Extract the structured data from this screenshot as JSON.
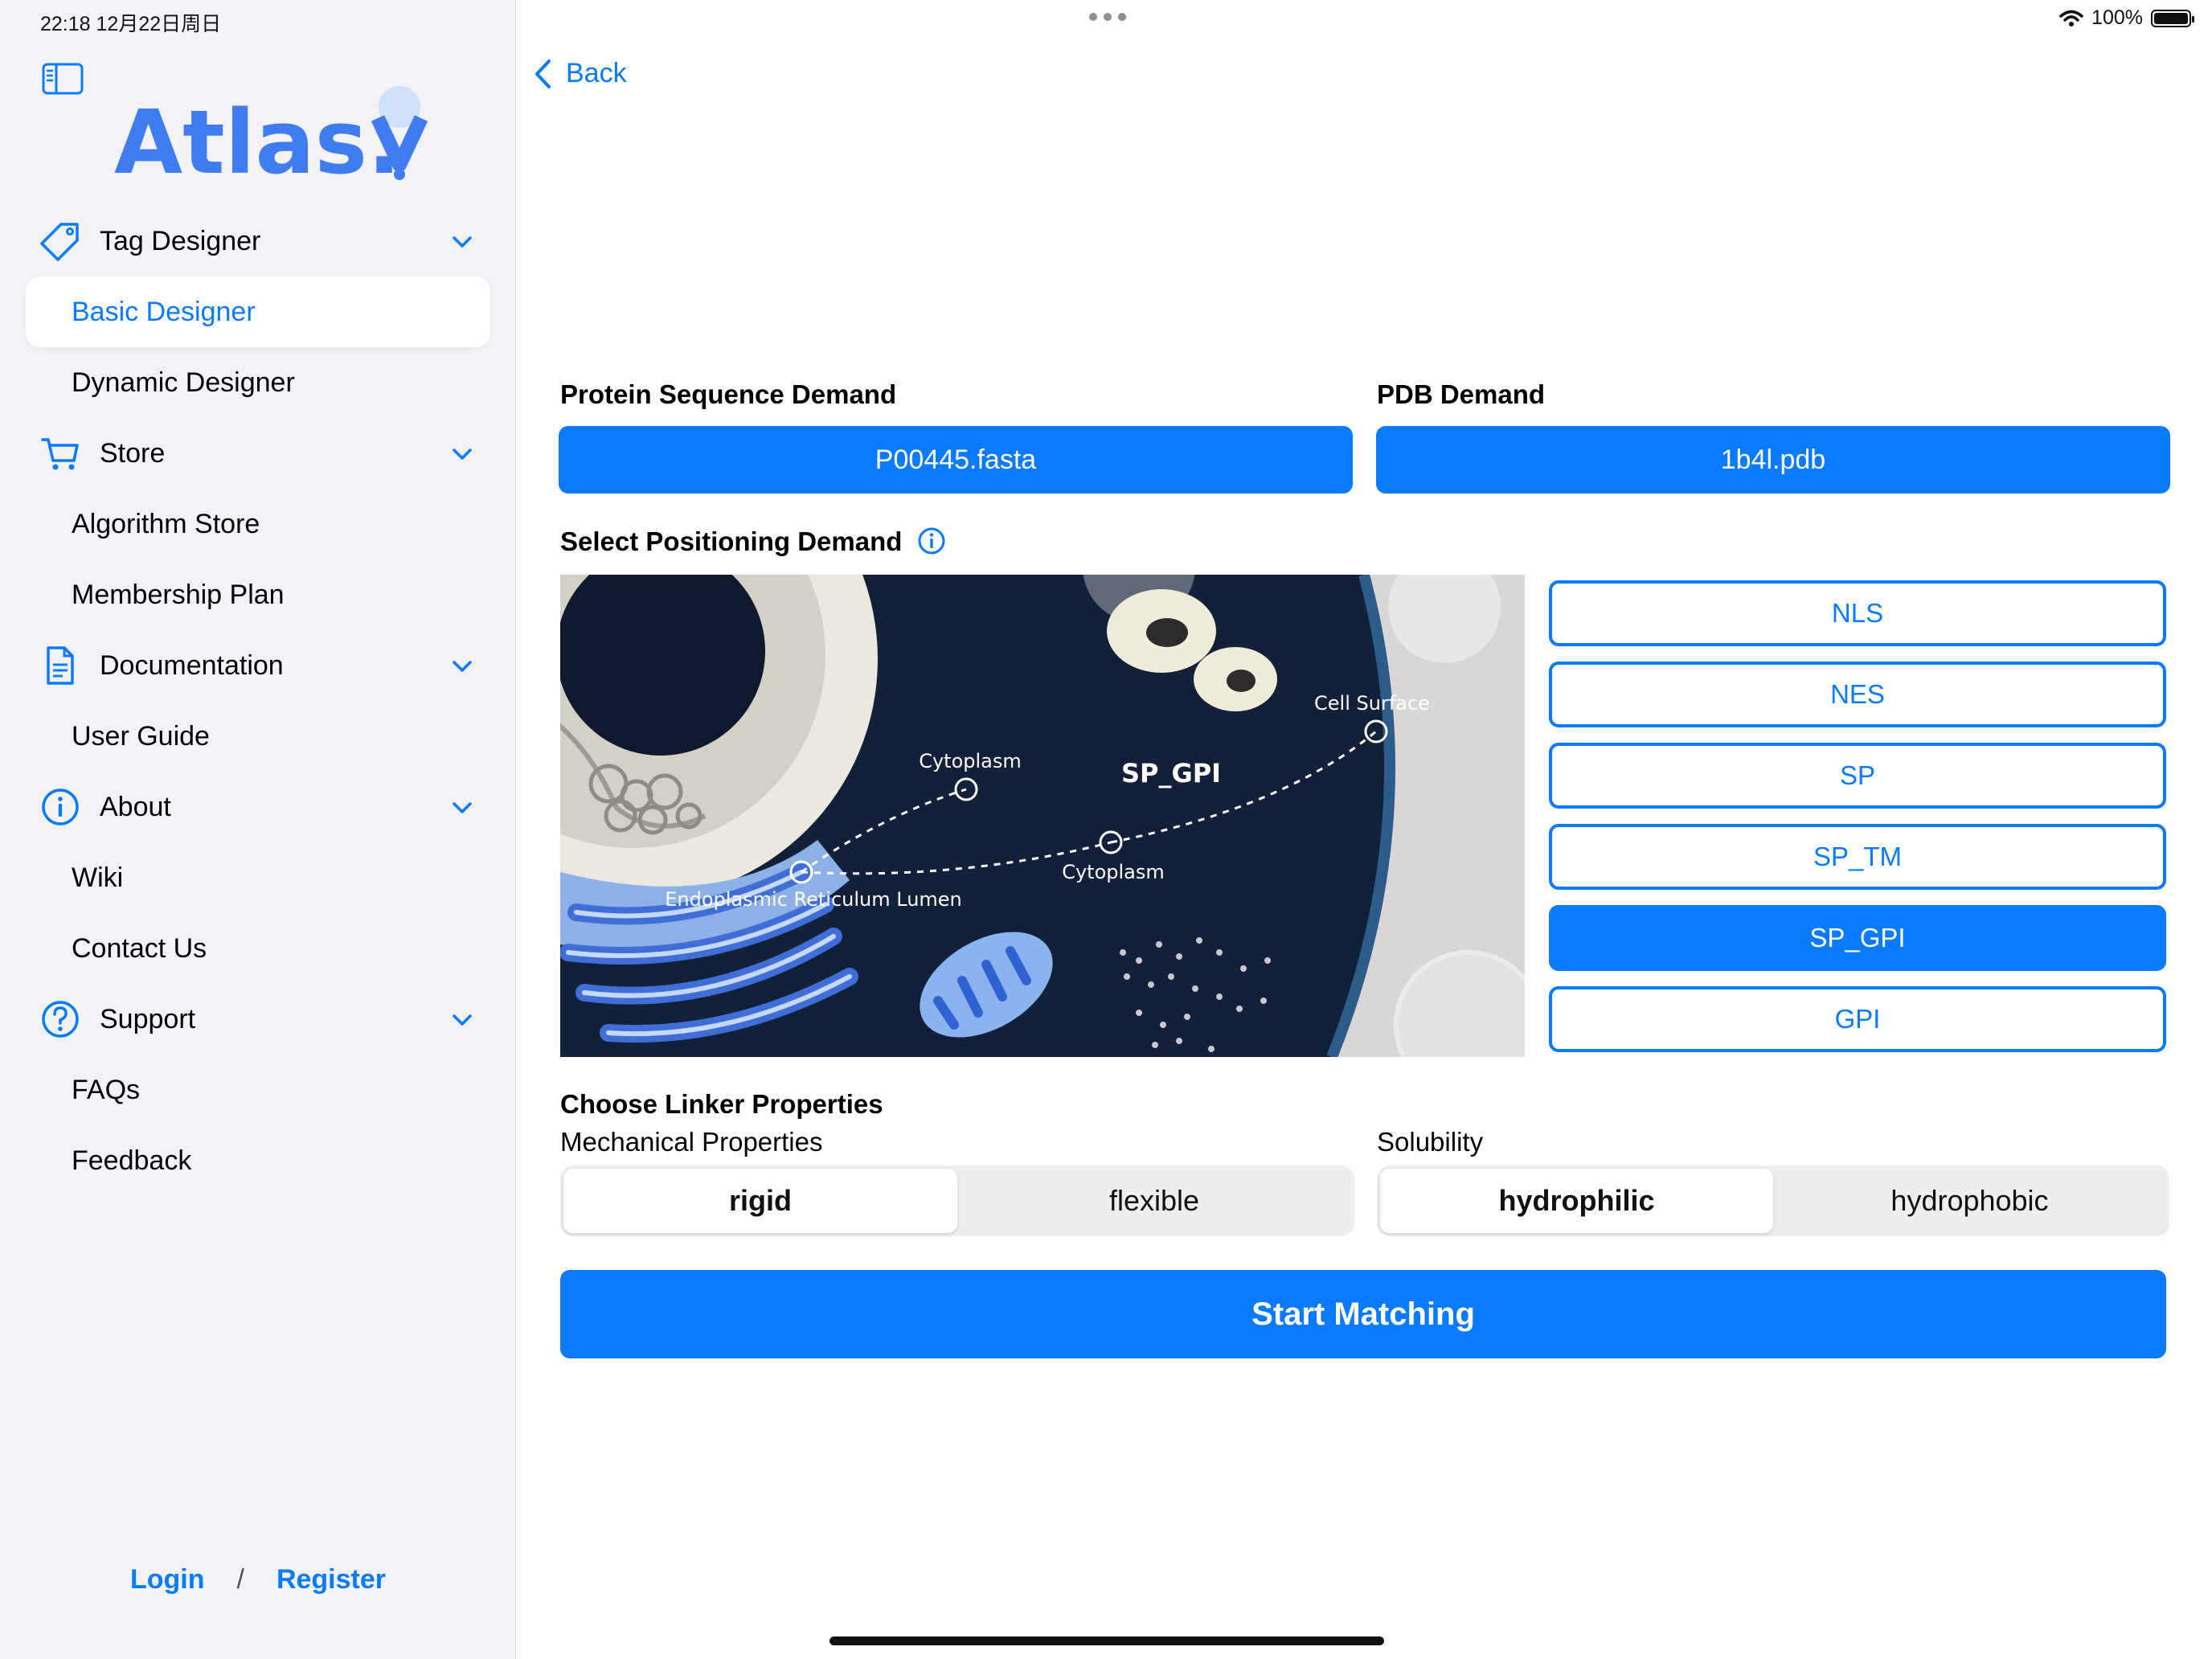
{
  "status_bar": {
    "time": "22:18   12月22日周日",
    "battery": "100%"
  },
  "sidebar": {
    "logo_text": "Atlas.",
    "sections": [
      {
        "label": "Tag Designer",
        "icon": "tag-icon",
        "items": [
          "Basic Designer",
          "Dynamic Designer"
        ]
      },
      {
        "label": "Store",
        "icon": "cart-icon",
        "items": [
          "Algorithm Store",
          "Membership Plan"
        ]
      },
      {
        "label": "Documentation",
        "icon": "document-icon",
        "items": [
          "User Guide"
        ]
      },
      {
        "label": "About",
        "icon": "info-icon",
        "items": [
          "Wiki",
          "Contact Us"
        ]
      },
      {
        "label": "Support",
        "icon": "question-icon",
        "items": [
          "FAQs",
          "Feedback"
        ]
      }
    ],
    "active_item": "Basic Designer",
    "auth": {
      "login": "Login",
      "separator": "/",
      "register": "Register"
    }
  },
  "main": {
    "back_label": "Back",
    "protein_label": "Protein Sequence Demand",
    "protein_file": "P00445.fasta",
    "pdb_label": "PDB Demand",
    "pdb_file": "1b4l.pdb",
    "positioning_label": "Select Positioning Demand",
    "illustration": {
      "title": "SP_GPI",
      "labels": {
        "cytoplasm_top": "Cytoplasm",
        "cell_surface": "Cell Surface",
        "cytoplasm_bottom": "Cytoplasm",
        "er_lumen": "Endoplasmic Reticulum Lumen"
      }
    },
    "positioning_options": [
      "NLS",
      "NES",
      "SP",
      "SP_TM",
      "SP_GPI",
      "GPI"
    ],
    "positioning_selected": "SP_GPI",
    "linker_label": "Choose Linker Properties",
    "mechanical": {
      "label": "Mechanical Properties",
      "options": [
        "rigid",
        "flexible"
      ],
      "selected": "rigid"
    },
    "solubility": {
      "label": "Solubility",
      "options": [
        "hydrophilic",
        "hydrophobic"
      ],
      "selected": "hydrophilic"
    },
    "start_button": "Start Matching"
  },
  "colors": {
    "accent": "#0a7aff",
    "sidebar_bg": "#f2f2f7",
    "cell_bg": "#13203a"
  }
}
